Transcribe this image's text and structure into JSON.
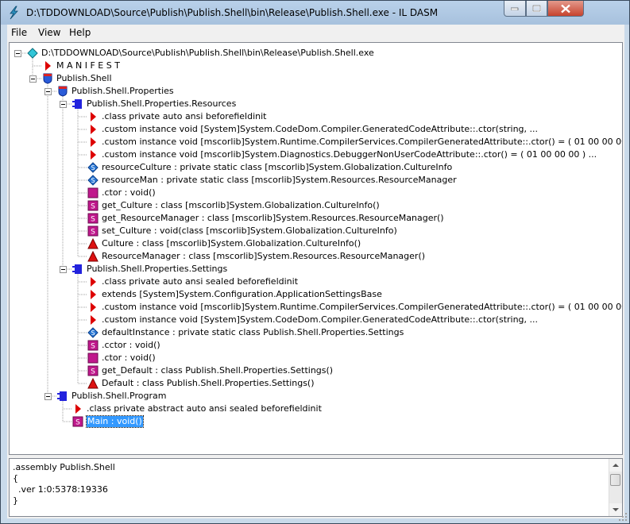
{
  "window": {
    "title": "D:\\TDDOWNLOAD\\Source\\Publish\\Publish.Shell\\bin\\Release\\Publish.Shell.exe - IL DASM"
  },
  "menu": [
    "File",
    "View",
    "Help"
  ],
  "colors": {
    "method": "#c0188c",
    "static_method": "#c0188c",
    "field": "#2b79d6",
    "class": "#2222dd",
    "namespace": "#2a5bd8",
    "info_marker": "#dd0000",
    "property": "#dd1111",
    "selection": "#3399ff"
  },
  "tree": [
    {
      "level": 0,
      "icon": "root-diamond-icon",
      "expander": true,
      "label": "D:\\TDDOWNLOAD\\Source\\Publish\\Publish.Shell\\bin\\Release\\Publish.Shell.exe"
    },
    {
      "level": 1,
      "icon": "manifest-marker-icon",
      "expander": false,
      "label": "M A N I F E S T"
    },
    {
      "level": 1,
      "icon": "namespace-shield-icon",
      "expander": true,
      "label": "Publish.Shell"
    },
    {
      "level": 2,
      "icon": "namespace-shield-icon",
      "expander": true,
      "label": "Publish.Shell.Properties"
    },
    {
      "level": 3,
      "icon": "class-icon",
      "expander": true,
      "label": "Publish.Shell.Properties.Resources"
    },
    {
      "level": 4,
      "icon": "info-marker-icon",
      "expander": false,
      "label": ".class private auto ansi beforefieldinit"
    },
    {
      "level": 4,
      "icon": "info-marker-icon",
      "expander": false,
      "label": ".custom instance void [System]System.CodeDom.Compiler.GeneratedCodeAttribute::.ctor(string, ..."
    },
    {
      "level": 4,
      "icon": "info-marker-icon",
      "expander": false,
      "label": ".custom instance void [mscorlib]System.Runtime.CompilerServices.CompilerGeneratedAttribute::.ctor() = ( 01 00 00 00 )  ..."
    },
    {
      "level": 4,
      "icon": "info-marker-icon",
      "expander": false,
      "label": ".custom instance void [mscorlib]System.Diagnostics.DebuggerNonUserCodeAttribute::.ctor() = ( 01 00 00 00 )  ..."
    },
    {
      "level": 4,
      "icon": "static-field-icon",
      "expander": false,
      "label": "resourceCulture : private static class [mscorlib]System.Globalization.CultureInfo"
    },
    {
      "level": 4,
      "icon": "static-field-icon",
      "expander": false,
      "label": "resourceMan : private static class [mscorlib]System.Resources.ResourceManager"
    },
    {
      "level": 4,
      "icon": "method-icon",
      "expander": false,
      "label": ".ctor : void()"
    },
    {
      "level": 4,
      "icon": "static-method-icon",
      "expander": false,
      "label": "get_Culture : class [mscorlib]System.Globalization.CultureInfo()"
    },
    {
      "level": 4,
      "icon": "static-method-icon",
      "expander": false,
      "label": "get_ResourceManager : class [mscorlib]System.Resources.ResourceManager()"
    },
    {
      "level": 4,
      "icon": "static-method-icon",
      "expander": false,
      "label": "set_Culture : void(class [mscorlib]System.Globalization.CultureInfo)"
    },
    {
      "level": 4,
      "icon": "property-icon",
      "expander": false,
      "label": "Culture : class [mscorlib]System.Globalization.CultureInfo()"
    },
    {
      "level": 4,
      "icon": "property-icon",
      "expander": false,
      "label": "ResourceManager : class [mscorlib]System.Resources.ResourceManager()"
    },
    {
      "level": 3,
      "icon": "class-icon",
      "expander": true,
      "label": "Publish.Shell.Properties.Settings"
    },
    {
      "level": 4,
      "icon": "info-marker-icon",
      "expander": false,
      "label": ".class private auto ansi sealed beforefieldinit"
    },
    {
      "level": 4,
      "icon": "info-marker-icon",
      "expander": false,
      "label": " extends [System]System.Configuration.ApplicationSettingsBase"
    },
    {
      "level": 4,
      "icon": "info-marker-icon",
      "expander": false,
      "label": ".custom instance void [mscorlib]System.Runtime.CompilerServices.CompilerGeneratedAttribute::.ctor() = ( 01 00 00 00 )  ..."
    },
    {
      "level": 4,
      "icon": "info-marker-icon",
      "expander": false,
      "label": ".custom instance void [System]System.CodeDom.Compiler.GeneratedCodeAttribute::.ctor(string, ..."
    },
    {
      "level": 4,
      "icon": "static-field-icon",
      "expander": false,
      "label": "defaultInstance : private static class Publish.Shell.Properties.Settings"
    },
    {
      "level": 4,
      "icon": "static-method-icon",
      "expander": false,
      "label": ".cctor : void()"
    },
    {
      "level": 4,
      "icon": "method-icon",
      "expander": false,
      "label": ".ctor : void()"
    },
    {
      "level": 4,
      "icon": "static-method-icon",
      "expander": false,
      "label": "get_Default : class Publish.Shell.Properties.Settings()"
    },
    {
      "level": 4,
      "icon": "property-icon",
      "expander": false,
      "label": "Default : class Publish.Shell.Properties.Settings()"
    },
    {
      "level": 2,
      "icon": "class-icon",
      "expander": true,
      "label": "Publish.Shell.Program"
    },
    {
      "level": 3,
      "icon": "info-marker-icon",
      "expander": false,
      "label": ".class private abstract auto ansi sealed beforefieldinit"
    },
    {
      "level": 3,
      "icon": "static-method-icon",
      "expander": false,
      "label": "Main : void()",
      "selected": true
    }
  ],
  "info": {
    "lines": [
      ".assembly Publish.Shell",
      "{",
      "  .ver 1:0:5378:19336",
      "}"
    ]
  }
}
